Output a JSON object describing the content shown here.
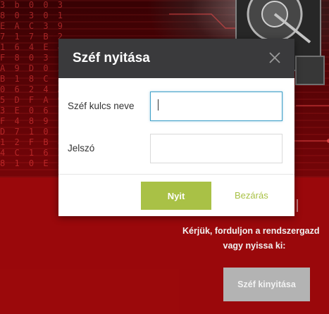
{
  "background": {
    "code_text": "3 b 0 0 3\n8 0 3 0 1\nE A C 3 9\n7 1 7 B 2\n1 6 4 E 4\nF 8 0 3 1\nA 9 D 0 5\nB 1 8 C 3\n0 6 2 4 A\n5 D F A 9\n3 E 0 6 F\nF 4 8 9 1\nD 7 1 0 5\n1 2 F B 8\n4 C 1 6 2\n8 1 0 E 3",
    "help_line1": "Kérjük, forduljon a rendszergazd",
    "help_line2": "vagy nyissa ki:",
    "open_safe_label": "Széf kinyitása"
  },
  "modal": {
    "title": "Széf nyitása",
    "fields": {
      "key_name_label": "Széf kulcs neve",
      "key_name_value": "",
      "password_label": "Jelszó",
      "password_value": ""
    },
    "submit_label": "Nyit",
    "close_label": "Bezárás"
  },
  "colors": {
    "accent_green": "#a9c146",
    "header_dark": "#3a3a3c",
    "background_red": "#a3090c",
    "focus_blue": "#3fa0c8"
  }
}
